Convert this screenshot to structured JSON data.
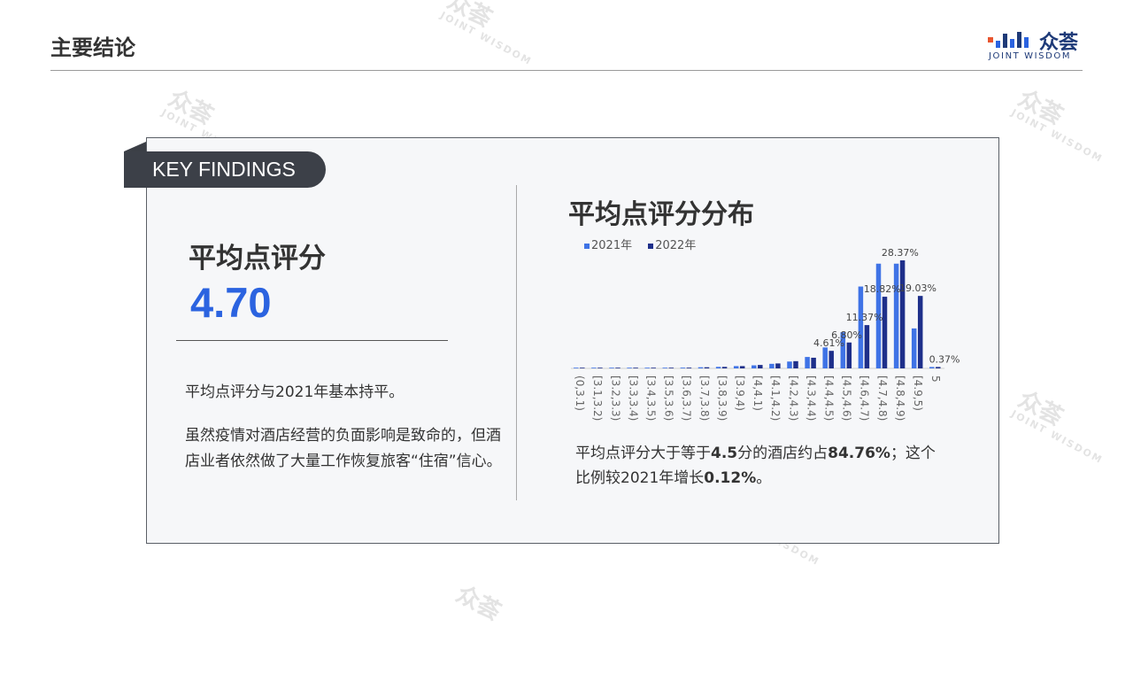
{
  "header": {
    "title": "主要结论",
    "logo_cn": "众荟",
    "logo_en": "JOINT WISDOM"
  },
  "watermark": {
    "logo_cn": "众荟",
    "text": "JOINT WISDOM"
  },
  "card": {
    "tab_label": "KEY FINDINGS",
    "metric_label": "平均点评分",
    "metric_value": "4.70",
    "note1": "平均点评分与2021年基本持平。",
    "note2": "虽然疫情对酒店经营的负面影响是致命的，但酒店业者依然做了大量工作恢复旅客“住宿”信心。"
  },
  "summary": {
    "p1": "平均点评分大于等于",
    "b1": "4.5",
    "p2": "分的酒店约占",
    "b2": "84.76%",
    "p3": "；这个比例较2021年增长",
    "b3": "0.12%",
    "p4": "。"
  },
  "colors": {
    "accent": "#2b63e0",
    "series2021": "#3f73e6",
    "series2022": "#1e2f8a",
    "tab": "#3c4048"
  },
  "chart_data": {
    "type": "bar",
    "title": "平均点评分分布",
    "categories": [
      "(0,3.1)",
      "[3.1,3.2)",
      "[3.2,3.3)",
      "[3.3,3.4)",
      "[3.4,3.5)",
      "[3.5,3.6)",
      "[3.6,3.7)",
      "[3.7,3.8)",
      "[3.8,3.9)",
      "[3.9,4)",
      "[4,4.1)",
      "[4.1,4.2)",
      "[4.2,4.3)",
      "[4.3,4.4)",
      "[4.4,4.5)",
      "[4.5,4.6)",
      "[4.6,4.7)",
      "[4.7,4.8)",
      "[4.8,4.9)",
      "[4.9,5)",
      "5"
    ],
    "series": [
      {
        "name": "2021年",
        "values": [
          0.1,
          0.05,
          0.1,
          0.1,
          0.1,
          0.15,
          0.2,
          0.3,
          0.4,
          0.6,
          0.8,
          1.2,
          1.8,
          3.0,
          5.5,
          9.5,
          21.5,
          27.5,
          27.5,
          10.5,
          0.37
        ]
      },
      {
        "name": "2022年",
        "values": [
          0.1,
          0.05,
          0.1,
          0.1,
          0.1,
          0.15,
          0.2,
          0.3,
          0.4,
          0.6,
          0.9,
          1.3,
          1.9,
          2.8,
          4.61,
          6.8,
          11.37,
          18.82,
          28.37,
          19.03,
          0.37
        ]
      }
    ],
    "data_labels": [
      {
        "index": 14,
        "series": 1,
        "text": "4.61%"
      },
      {
        "index": 15,
        "series": 1,
        "text": "6.80%"
      },
      {
        "index": 16,
        "series": 1,
        "text": "11.37%"
      },
      {
        "index": 17,
        "series": 1,
        "text": "18.82%"
      },
      {
        "index": 18,
        "series": 1,
        "text": "28.37%"
      },
      {
        "index": 19,
        "series": 1,
        "text": "19.03%"
      },
      {
        "index": 20,
        "series": 1,
        "text": "0.37%"
      }
    ],
    "ylim": [
      0,
      30
    ],
    "grid": false,
    "legend": "top-left"
  }
}
